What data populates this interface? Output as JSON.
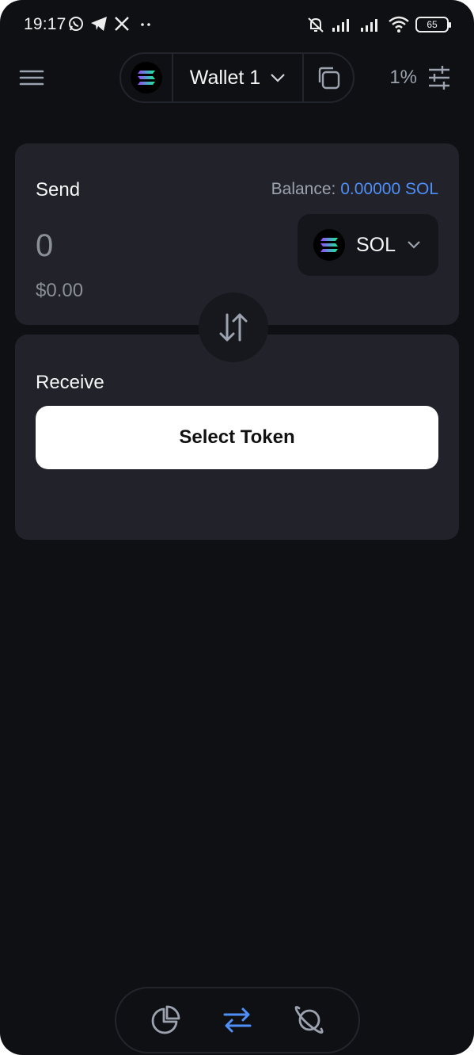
{
  "status_bar": {
    "time": "19:17",
    "battery": "65"
  },
  "header": {
    "wallet_name": "Wallet 1",
    "slippage": "1%"
  },
  "send": {
    "title": "Send",
    "balance_label": "Balance:",
    "balance_value": "0.00000 SOL",
    "amount": "0",
    "usd_value": "$0.00",
    "token_symbol": "SOL"
  },
  "receive": {
    "title": "Receive",
    "select_token_label": "Select Token"
  },
  "nav": {
    "active": "swap",
    "items": [
      "portfolio",
      "swap",
      "explore"
    ]
  },
  "colors": {
    "background": "#0f1014",
    "card": "#22232a",
    "accent": "#4f8ff7"
  }
}
